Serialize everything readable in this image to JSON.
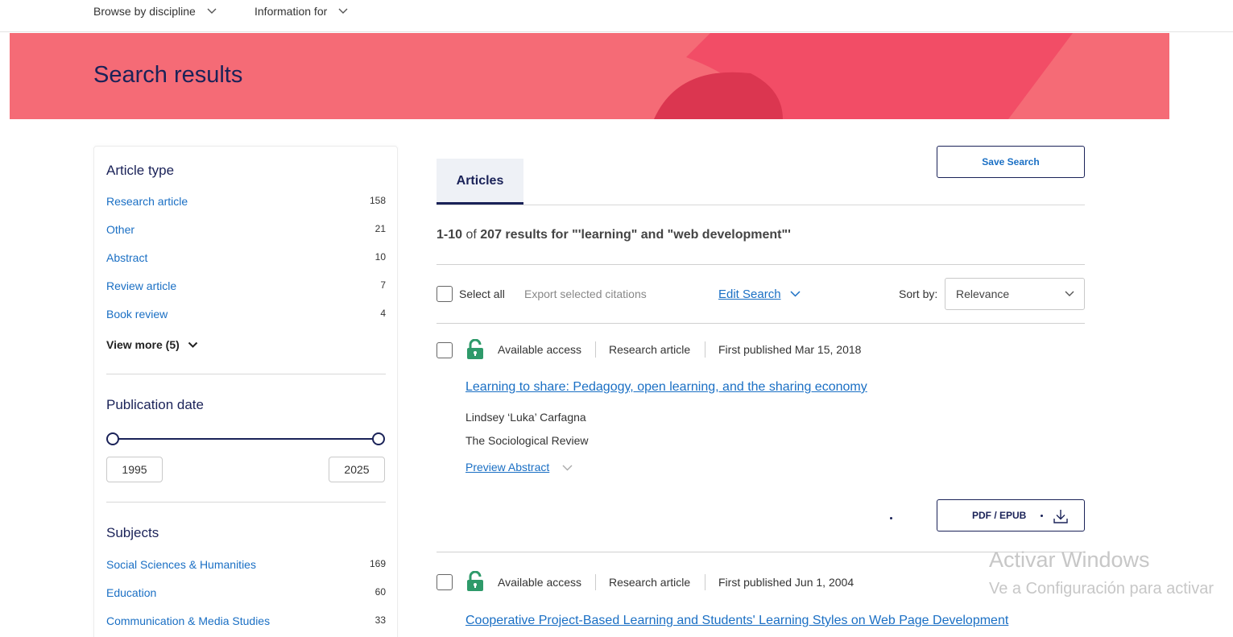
{
  "nav": {
    "browse": "Browse by discipline",
    "info": "Information for"
  },
  "banner": {
    "title": "Search results",
    "color": "#f56b76"
  },
  "sidebar": {
    "article_type": {
      "heading": "Article type",
      "items": [
        {
          "label": "Research article",
          "count": "158"
        },
        {
          "label": "Other",
          "count": "21"
        },
        {
          "label": "Abstract",
          "count": "10"
        },
        {
          "label": "Review article",
          "count": "7"
        },
        {
          "label": "Book review",
          "count": "4"
        }
      ],
      "view_more": "View more (5)"
    },
    "publication_date": {
      "heading": "Publication date",
      "from": "1995",
      "to": "2025"
    },
    "subjects": {
      "heading": "Subjects",
      "items": [
        {
          "label": "Social Sciences & Humanities",
          "count": "169"
        },
        {
          "label": "Education",
          "count": "60"
        },
        {
          "label": "Communication & Media Studies",
          "count": "33"
        }
      ]
    }
  },
  "main": {
    "tab": "Articles",
    "save_search": "Save Search",
    "results_count": {
      "range": "1-10",
      "of": "of",
      "total": "207 results for \"'learning\" and \"web development\"'"
    },
    "toolbar": {
      "select_all": "Select all",
      "export": "Export selected citations",
      "edit_search": "Edit Search",
      "sort_label": "Sort by:",
      "sort_value": "Relevance"
    },
    "results": [
      {
        "access": "Available access",
        "type": "Research article",
        "published": "First published Mar 15, 2018",
        "title": "Learning to share: Pedagogy, open learning, and the sharing economy",
        "author": "Lindsey ‘Luka’ Carfagna",
        "journal": "The Sociological Review",
        "preview": "Preview Abstract",
        "pdf": "PDF / EPUB"
      },
      {
        "access": "Available access",
        "type": "Research article",
        "published": "First published Jun 1, 2004",
        "title": "Cooperative Project-Based Learning and Students' Learning Styles on Web Page Development"
      }
    ]
  },
  "watermark": {
    "line1": "Activar Windows",
    "line2": "Ve a Configuración para activar"
  },
  "icons": [
    "chevron-down-icon",
    "lock-open-icon",
    "download-icon"
  ],
  "colors": {
    "accent": "#1a2258",
    "link": "#1a6fc4",
    "access_green": "#2e9a6a"
  }
}
